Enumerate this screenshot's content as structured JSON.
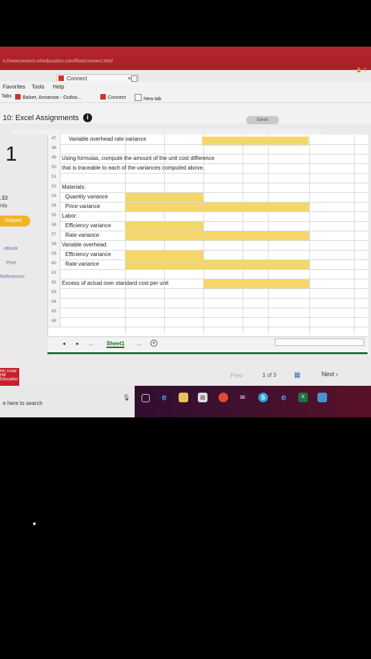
{
  "browser": {
    "url": "s://newconnect.mheducation.com/flow/connect.html",
    "url_right": "- 🔒 C",
    "tab_label": "Connect",
    "tab_close": "×",
    "menu": [
      "Favorites",
      "Tools",
      "Help"
    ],
    "favorites": [
      {
        "label": "Tabs",
        "color": ""
      },
      {
        "label": "Balser, Annarose - Outloo...",
        "color": "#d23127"
      },
      {
        "label": "Connect",
        "color": "#d23127"
      },
      {
        "label": "New tab",
        "color": "#ffffff"
      }
    ]
  },
  "assignment": {
    "title": "10: Excel Assignments",
    "info_icon_text": "i",
    "status": "Saved",
    "question_number": "1",
    "points_value": ".33",
    "points_label": "nts",
    "skipped_label": "Skipped",
    "links": [
      "eBook",
      "Print",
      "References"
    ]
  },
  "spreadsheet": {
    "rows": [
      {
        "num": "47",
        "text": "Variable overhead rate variance",
        "indent": 2
      },
      {
        "num": "48",
        "text": "",
        "indent": 0
      },
      {
        "num": "49",
        "text": "Using formulas, compute the amount of the unit cost difference",
        "indent": 0
      },
      {
        "num": "50",
        "text": "that is traceable to each of the variances computed above.",
        "indent": 0
      },
      {
        "num": "51",
        "text": "",
        "indent": 0
      },
      {
        "num": "52",
        "text": "Materials:",
        "indent": 0
      },
      {
        "num": "53",
        "text": "Quantity variance",
        "indent": 1
      },
      {
        "num": "54",
        "text": "Price variance",
        "indent": 1
      },
      {
        "num": "55",
        "text": "Labor:",
        "indent": 0
      },
      {
        "num": "56",
        "text": "Efficiency variance",
        "indent": 1
      },
      {
        "num": "57",
        "text": "Rate variance",
        "indent": 1
      },
      {
        "num": "58",
        "text": "Variable overhead:",
        "indent": 0
      },
      {
        "num": "59",
        "text": "Efficiency variance",
        "indent": 1
      },
      {
        "num": "60",
        "text": "Rate variance",
        "indent": 1
      },
      {
        "num": "61",
        "text": "",
        "indent": 0
      },
      {
        "num": "62",
        "text": "Excess of actual over standard cost per unit",
        "indent": 0
      },
      {
        "num": "63",
        "text": "",
        "indent": 0
      },
      {
        "num": "64",
        "text": "",
        "indent": 0
      },
      {
        "num": "65",
        "text": "",
        "indent": 0
      },
      {
        "num": "66",
        "text": "",
        "indent": 0
      }
    ],
    "sheet_nav": [
      "◂",
      "▸",
      "..."
    ],
    "sheet_tab": "Sheet1",
    "sheet_more": "...",
    "add_sheet": "+",
    "input_color": "#f3d76b"
  },
  "footer": {
    "prev": "Prev",
    "page_current": "1",
    "page_of": "of 3",
    "next": "Next",
    "next_arrow": "›",
    "logo_text": "Mc Graw Hill Education"
  },
  "taskbar": {
    "search_placeholder": "e here to search",
    "icons": [
      "microphone-icon",
      "task-view-icon",
      "edge-icon",
      "file-explorer-icon",
      "store-icon",
      "chrome-icon",
      "mail-icon",
      "skype-icon",
      "ie-icon",
      "excel-icon",
      "photos-icon"
    ]
  }
}
